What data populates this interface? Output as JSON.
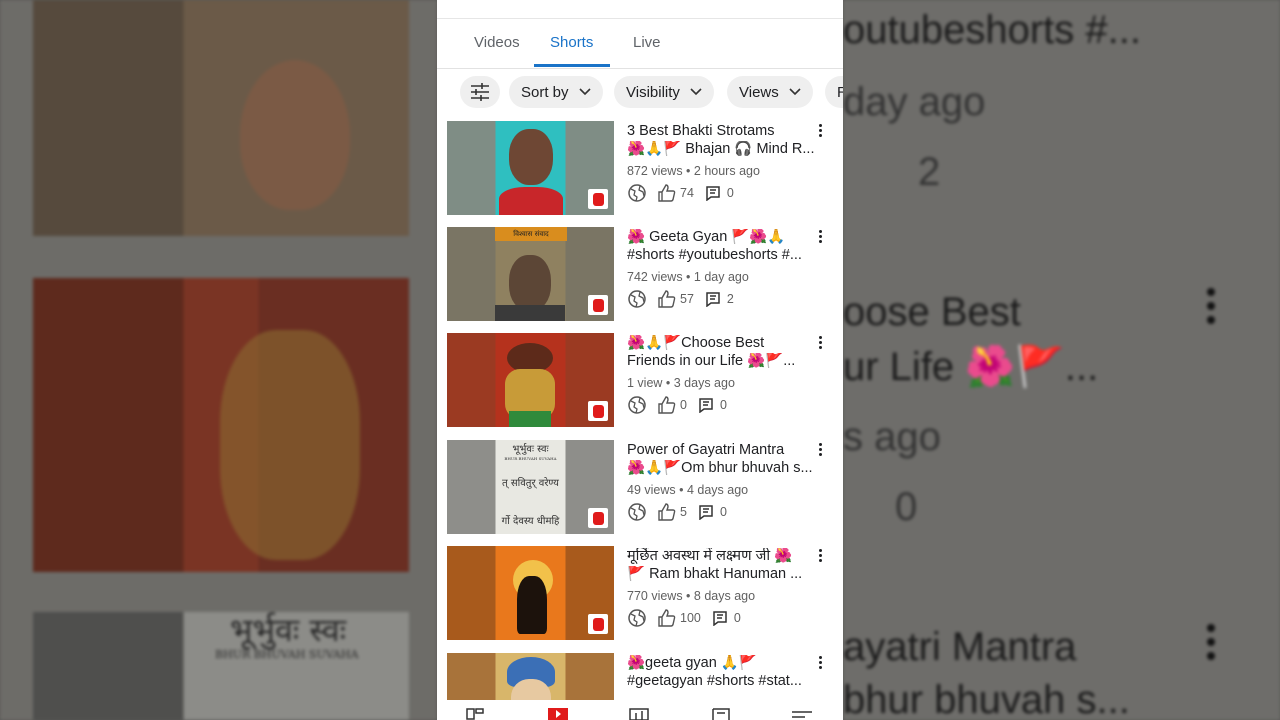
{
  "tabs": [
    "Videos",
    "Shorts",
    "Live"
  ],
  "active_tab": "Shorts",
  "filters": {
    "sort_by": "Sort by",
    "visibility": "Visibility",
    "views": "Views",
    "partial": "R"
  },
  "videos": [
    {
      "title1": "3 Best Bhakti Strotams",
      "title2": "🌺🙏🚩 Bhajan 🎧 Mind R...",
      "meta": "872 views • 2 hours ago",
      "likes": "74",
      "comments": "0"
    },
    {
      "title1": "🌺 Geeta Gyan 🚩🌺🙏",
      "title2": "#shorts #youtubeshorts #...",
      "meta": "742 views • 1 day ago",
      "likes": "57",
      "comments": "2"
    },
    {
      "title1": "🌺🙏🚩Choose Best",
      "title2": "Friends in our Life 🌺🚩...",
      "meta": "1 view • 3 days ago",
      "likes": "0",
      "comments": "0"
    },
    {
      "title1": "Power of Gayatri Mantra",
      "title2": "🌺🙏🚩Om bhur bhuvah s...",
      "meta": "49 views • 4 days ago",
      "likes": "5",
      "comments": "0"
    },
    {
      "title1": "मूर्छित अवस्था में लक्ष्मण जी 🌺",
      "title2": "🚩 Ram bhakt Hanuman ...",
      "meta": "770 views • 8 days ago",
      "likes": "100",
      "comments": "0"
    },
    {
      "title1": "🌺geeta gyan 🙏🚩",
      "title2": "#geetagyan #shorts #stat...",
      "meta": "",
      "likes": "",
      "comments": ""
    }
  ],
  "thumb_texts": {
    "video2_banner": "विश्वास संवाद",
    "video4_line1": "भूर्भुवः स्वः",
    "video4_line2": "BHUR BHUVAH SUVAHA",
    "video4_line3": "त् सवितुर् वरेण्य",
    "video4_line4": "र्गो देवस्य धीमहि"
  },
  "background_text": {
    "right1": "outubeshorts #...",
    "right2": "day ago",
    "right3": "2",
    "right4": "oose Best",
    "right5": "ur Life 🌺🚩...",
    "right6": "s ago",
    "right7": "0",
    "right8": "ayatri Mantra",
    "right9": "bhur bhuvah s...",
    "left1": "भूर्भुवः स्वः",
    "left2": "BHUR BHUVAH SUVAHA"
  },
  "colors": {
    "accent": "#1a73c8",
    "shorts_red": "#e01b1b"
  }
}
